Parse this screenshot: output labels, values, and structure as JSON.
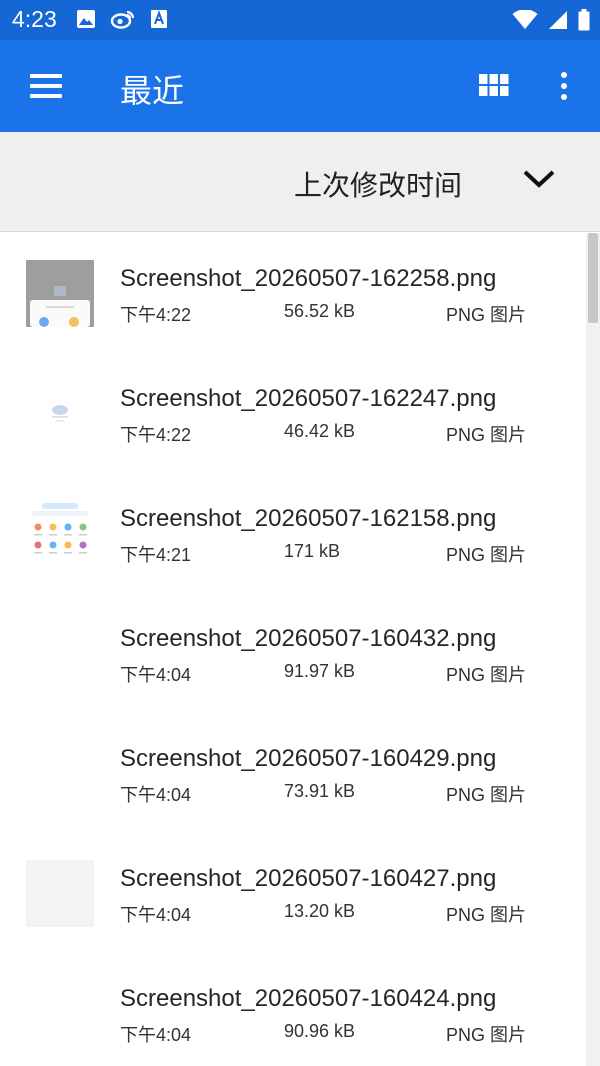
{
  "status_bar": {
    "time": "4:23",
    "left_icons": [
      "image-icon",
      "weibo-icon",
      "text-a-icon"
    ],
    "right_icons": [
      "wifi-icon",
      "signal-icon",
      "battery-icon"
    ]
  },
  "app_bar": {
    "title": "最近",
    "background": "#1a73e8",
    "menu_icon": "hamburger-menu-icon",
    "grid_icon": "grid-view-icon",
    "more_icon": "more-vertical-icon"
  },
  "sort": {
    "label": "上次修改时间",
    "chevron_icon": "chevron-down-icon"
  },
  "files": [
    {
      "name": "Screenshot_20260507-162258.png",
      "date": "下午4:22",
      "size": "56.52 kB",
      "type": "PNG 图片"
    },
    {
      "name": "Screenshot_20260507-162247.png",
      "date": "下午4:22",
      "size": "46.42 kB",
      "type": "PNG 图片"
    },
    {
      "name": "Screenshot_20260507-162158.png",
      "date": "下午4:21",
      "size": "171 kB",
      "type": "PNG 图片"
    },
    {
      "name": "Screenshot_20260507-160432.png",
      "date": "下午4:04",
      "size": "91.97 kB",
      "type": "PNG 图片"
    },
    {
      "name": "Screenshot_20260507-160429.png",
      "date": "下午4:04",
      "size": "73.91 kB",
      "type": "PNG 图片"
    },
    {
      "name": "Screenshot_20260507-160427.png",
      "date": "下午4:04",
      "size": "13.20 kB",
      "type": "PNG 图片"
    },
    {
      "name": "Screenshot_20260507-160424.png",
      "date": "下午4:04",
      "size": "90.96 kB",
      "type": "PNG 图片"
    }
  ]
}
